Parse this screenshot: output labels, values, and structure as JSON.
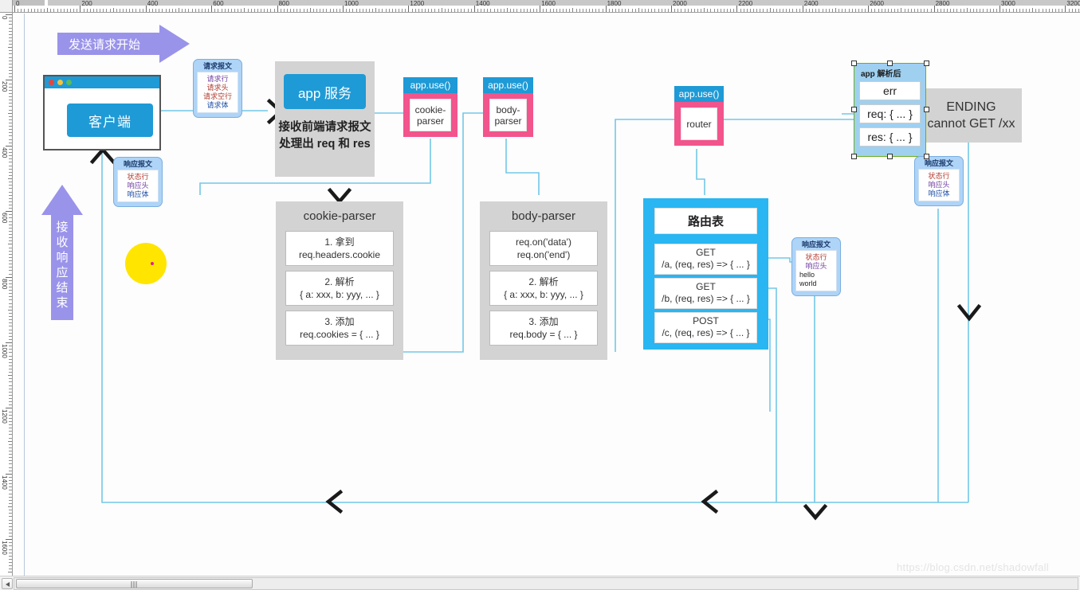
{
  "rulers": {
    "horizontal_labels": [
      "0",
      "200",
      "400",
      "600",
      "800",
      "1000",
      "1200",
      "1400",
      "1600",
      "1800",
      "2000",
      "2200",
      "2400",
      "2600",
      "2800",
      "3000",
      "3200"
    ],
    "vertical_labels": [
      "0",
      "200",
      "400",
      "600",
      "800",
      "1000",
      "1200",
      "1400",
      "1600"
    ]
  },
  "flow": {
    "send_arrow_label": "发送请求开始",
    "receive_arrow_label": "接收响应结束"
  },
  "client": {
    "label": "客户端"
  },
  "request_msg": {
    "title": "请求报文",
    "lines": [
      "请求行",
      "请求头",
      "请求空行",
      "请求体"
    ]
  },
  "response_msg_client": {
    "title": "响应报文",
    "lines": [
      "状态行",
      "响应头",
      "响应体"
    ]
  },
  "response_msg_router": {
    "title": "响应报文",
    "lines": [
      "状态行",
      "响应头",
      "hello world"
    ]
  },
  "response_msg_ending": {
    "title": "响应报文",
    "lines": [
      "状态行",
      "响应头",
      "响应体"
    ]
  },
  "app_service": {
    "title": "app 服务",
    "desc_line1": "接收前端请求报文",
    "desc_line2": "处理出 req 和 res"
  },
  "middleware": [
    {
      "tab": "app.use()",
      "name": "cookie-\nparser",
      "name_l1": "cookie-",
      "name_l2": "parser"
    },
    {
      "tab": "app.use()",
      "name_l1": "body-",
      "name_l2": "parser"
    },
    {
      "tab": "app.use()",
      "name_l1": "router",
      "name_l2": ""
    }
  ],
  "cookie_parser_panel": {
    "title": "cookie-parser",
    "items": [
      {
        "l1": "1. 拿到",
        "l2": "req.headers.cookie"
      },
      {
        "l1": "2. 解析",
        "l2": "{ a: xxx, b: yyy, ... }"
      },
      {
        "l1": "3. 添加",
        "l2": "req.cookies = { ... }"
      }
    ]
  },
  "body_parser_panel": {
    "title": "body-parser",
    "items": [
      {
        "l1": "req.on('data')",
        "l2": "req.on('end')"
      },
      {
        "l1": "2. 解析",
        "l2": "{ a: xxx, b: yyy, ... }"
      },
      {
        "l1": "3. 添加",
        "l2": "req.body = { ... }"
      }
    ]
  },
  "route_table": {
    "title": "路由表",
    "items": [
      {
        "method": "GET",
        "handler": "/a, (req, res) => { ... }"
      },
      {
        "method": "GET",
        "handler": "/b, (req, res) => { ... }"
      },
      {
        "method": "POST",
        "handler": "/c, (req, res) => { ... }"
      }
    ]
  },
  "app_parsed_box": {
    "title": "app 解析后",
    "items": [
      "err",
      "req: { ... }",
      "res: { ... }"
    ]
  },
  "ending_box": {
    "line1": "ENDING",
    "line2": "cannot GET /xx"
  },
  "watermark": "https://blog.csdn.net/shadowfall",
  "colors": {
    "blue": "#1e9ad6",
    "bright_blue": "#29b6f2",
    "pink": "#f2548c",
    "purple": "#9a93ea",
    "gray_panel": "#d3d3d3",
    "connector": "#73c8e8",
    "msg_bubble": "#aed4f7",
    "yellow": "#ffe500",
    "selection_green": "#6fae1f"
  }
}
